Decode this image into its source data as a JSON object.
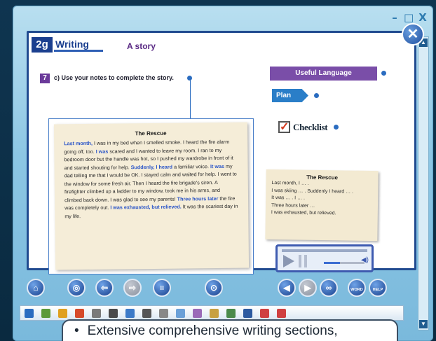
{
  "window": {
    "controls": [
      "–",
      "□",
      "X"
    ]
  },
  "header": {
    "badge": "2g",
    "section": "Writing",
    "subtitle": "A story",
    "close_label": "✕"
  },
  "task": {
    "number": "7",
    "text": "c) Use your notes to complete the story."
  },
  "sidebar": {
    "useful_language": "Useful Language",
    "plan": "Plan",
    "checklist": "Checklist"
  },
  "story": {
    "title": "The Rescue",
    "segments": [
      {
        "t": "Last month,",
        "hl": true
      },
      {
        "t": " I was in my bed when I smelled smoke. I heard the fire alarm going off, too. ",
        "hl": false
      },
      {
        "t": "I was",
        "hl": true
      },
      {
        "t": " scared and I wanted to leave my room. I ran to my bedroom door but the handle was hot, so I pushed my wardrobe in front of it and started shouting for help. ",
        "hl": false
      },
      {
        "t": "Suddenly, I heard",
        "hl": true
      },
      {
        "t": " a familiar voice. ",
        "hl": false
      },
      {
        "t": "It was",
        "hl": true
      },
      {
        "t": " my dad telling me that I would be OK. I stayed calm and waited for help. I went to the window for some fresh air. Then I heard the fire brigade's siren. A firefighter climbed up a ladder to my window, took me in his arms, and climbed back down. I was glad to see my parents! ",
        "hl": false
      },
      {
        "t": "Three hours later",
        "hl": true
      },
      {
        "t": " the fire was completely out. ",
        "hl": false
      },
      {
        "t": "I was exhausted, but relieved.",
        "hl": true
      },
      {
        "t": " It was the scariest day in my life.",
        "hl": false
      }
    ]
  },
  "outline": {
    "title": "The Rescue",
    "lines": [
      "Last month, I … .",
      "I was skiing … . Suddenly I heard … .",
      "It was … . I … .",
      "Three hours later …",
      "I was exhausted, but relieved."
    ]
  },
  "nav_buttons": [
    {
      "name": "home-button",
      "glyph": "⌂"
    },
    {
      "name": "audio-button",
      "glyph": "◎"
    },
    {
      "name": "back-button",
      "glyph": "⇦"
    },
    {
      "name": "forward-button",
      "glyph": "⇨"
    },
    {
      "name": "menu-button",
      "glyph": "≡"
    },
    {
      "name": "search-button",
      "glyph": "⊙"
    },
    {
      "name": "previous-page-button",
      "glyph": "◀"
    },
    {
      "name": "next-page-button",
      "glyph": "▶"
    },
    {
      "name": "link-button",
      "glyph": "∞"
    },
    {
      "name": "word-check-button",
      "glyph": "WORD CHECK"
    },
    {
      "name": "help-button",
      "glyph": "HELP"
    }
  ],
  "caption": {
    "bullet": "•",
    "text": "Extensive comprehensive writing sections,"
  },
  "colors": {
    "brand": "#1b3f8f",
    "purple": "#7a4ea8",
    "highlight": "#2a55c8"
  }
}
